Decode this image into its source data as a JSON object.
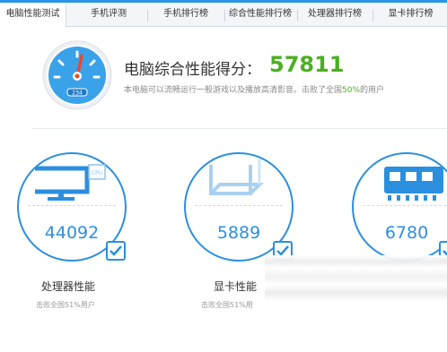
{
  "tabs": [
    {
      "label": "电脑性能测试",
      "active": true
    },
    {
      "label": "手机评测",
      "active": false
    },
    {
      "label": "手机排行榜",
      "active": false
    },
    {
      "label": "综合性能排行榜",
      "active": false
    },
    {
      "label": "处理器排行榜",
      "active": false
    },
    {
      "label": "显卡排行榜",
      "active": false
    }
  ],
  "summary": {
    "title": "电脑综合性能得分：",
    "score": "57811",
    "desc_prefix": "本电脑可以流畅运行一般游戏以及播放高清影音。击败了全国",
    "desc_percent": "50%",
    "desc_suffix": "的用户",
    "gauge_readout": "234"
  },
  "cards": [
    {
      "icon": "monitor-cpu-icon",
      "score": "44092",
      "label": "处理器性能",
      "sub": "击败全国51%用户",
      "checked": true
    },
    {
      "icon": "graphics-card-icon",
      "score": "5889",
      "label": "显卡性能",
      "sub": "击败全国51%用",
      "checked": true
    },
    {
      "icon": "memory-chip-icon",
      "score": "6780",
      "label": "",
      "sub": "",
      "checked": true
    }
  ],
  "colors": {
    "accent": "#2b8fe0",
    "score_green": "#4caf22",
    "gauge_red": "#e8492f"
  }
}
